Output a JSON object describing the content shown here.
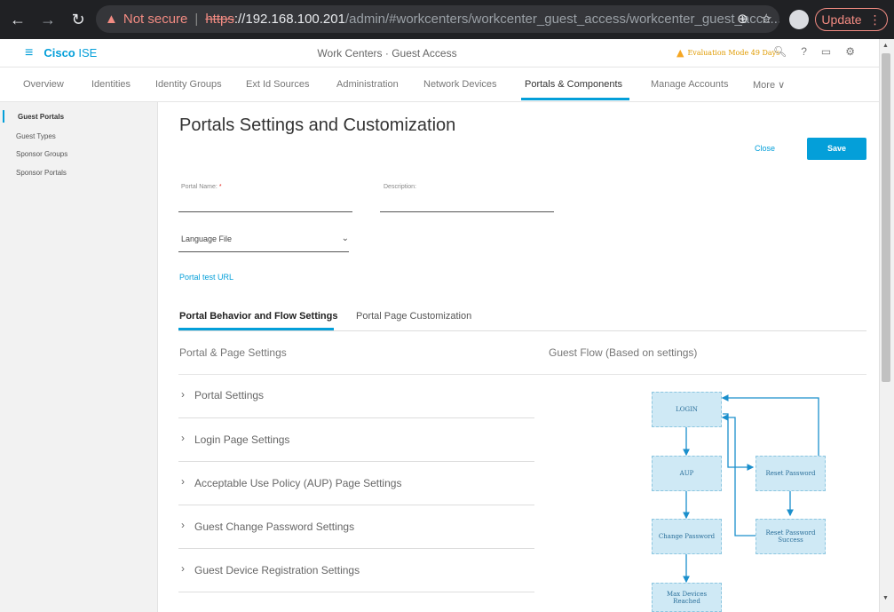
{
  "browser": {
    "not_secure": "Not secure",
    "scheme": "https",
    "host": "://192.168.100.201",
    "path": "/admin/#workcenters/workcenter_guest_access/workcenter_guest_acce...",
    "update_label": "Update"
  },
  "header": {
    "brand_bold": "Cisco",
    "brand_light": " ISE",
    "center_title": "Work Centers · Guest Access",
    "evaluation": "Evaluation Mode 49 Days"
  },
  "tabs": [
    {
      "label": "Overview"
    },
    {
      "label": "Identities"
    },
    {
      "label": "Identity Groups"
    },
    {
      "label": "Ext Id Sources"
    },
    {
      "label": "Administration"
    },
    {
      "label": "Network Devices"
    },
    {
      "label": "Portals & Components"
    },
    {
      "label": "Manage Accounts"
    },
    {
      "label": "More ∨"
    }
  ],
  "sidebar": {
    "items": [
      {
        "label": "Guest Portals"
      },
      {
        "label": "Guest Types"
      },
      {
        "label": "Sponsor Groups"
      },
      {
        "label": "Sponsor Portals"
      }
    ]
  },
  "main": {
    "title": "Portals Settings and Customization",
    "close_label": "Close",
    "save_label": "Save",
    "portal_name_label": "Portal Name:",
    "required_mark": "*",
    "portal_name_value": "",
    "description_label": "Description:",
    "description_value": "",
    "language_file_label": "Language File",
    "portal_test_url": "Portal test URL",
    "sub_tabs": [
      {
        "label": "Portal Behavior and Flow Settings"
      },
      {
        "label": "Portal Page Customization"
      }
    ],
    "left_section_title": "Portal & Page Settings",
    "right_section_title": "Guest Flow (Based on settings)",
    "accordion": [
      {
        "label": "Portal Settings"
      },
      {
        "label": "Login Page Settings"
      },
      {
        "label": "Acceptable Use Policy (AUP) Page Settings"
      },
      {
        "label": "Guest Change Password Settings"
      },
      {
        "label": "Guest Device Registration Settings"
      }
    ]
  },
  "flow": {
    "nodes": [
      {
        "label": "LOGIN"
      },
      {
        "label": "AUP"
      },
      {
        "label": "Change Password"
      },
      {
        "label": "Max Devices Reached"
      },
      {
        "label": "Reset Password"
      },
      {
        "label": "Reset Password Success"
      }
    ],
    "color": "#1a8fcc"
  },
  "colors": {
    "accent": "#049fd9",
    "warning": "#f5a623"
  }
}
